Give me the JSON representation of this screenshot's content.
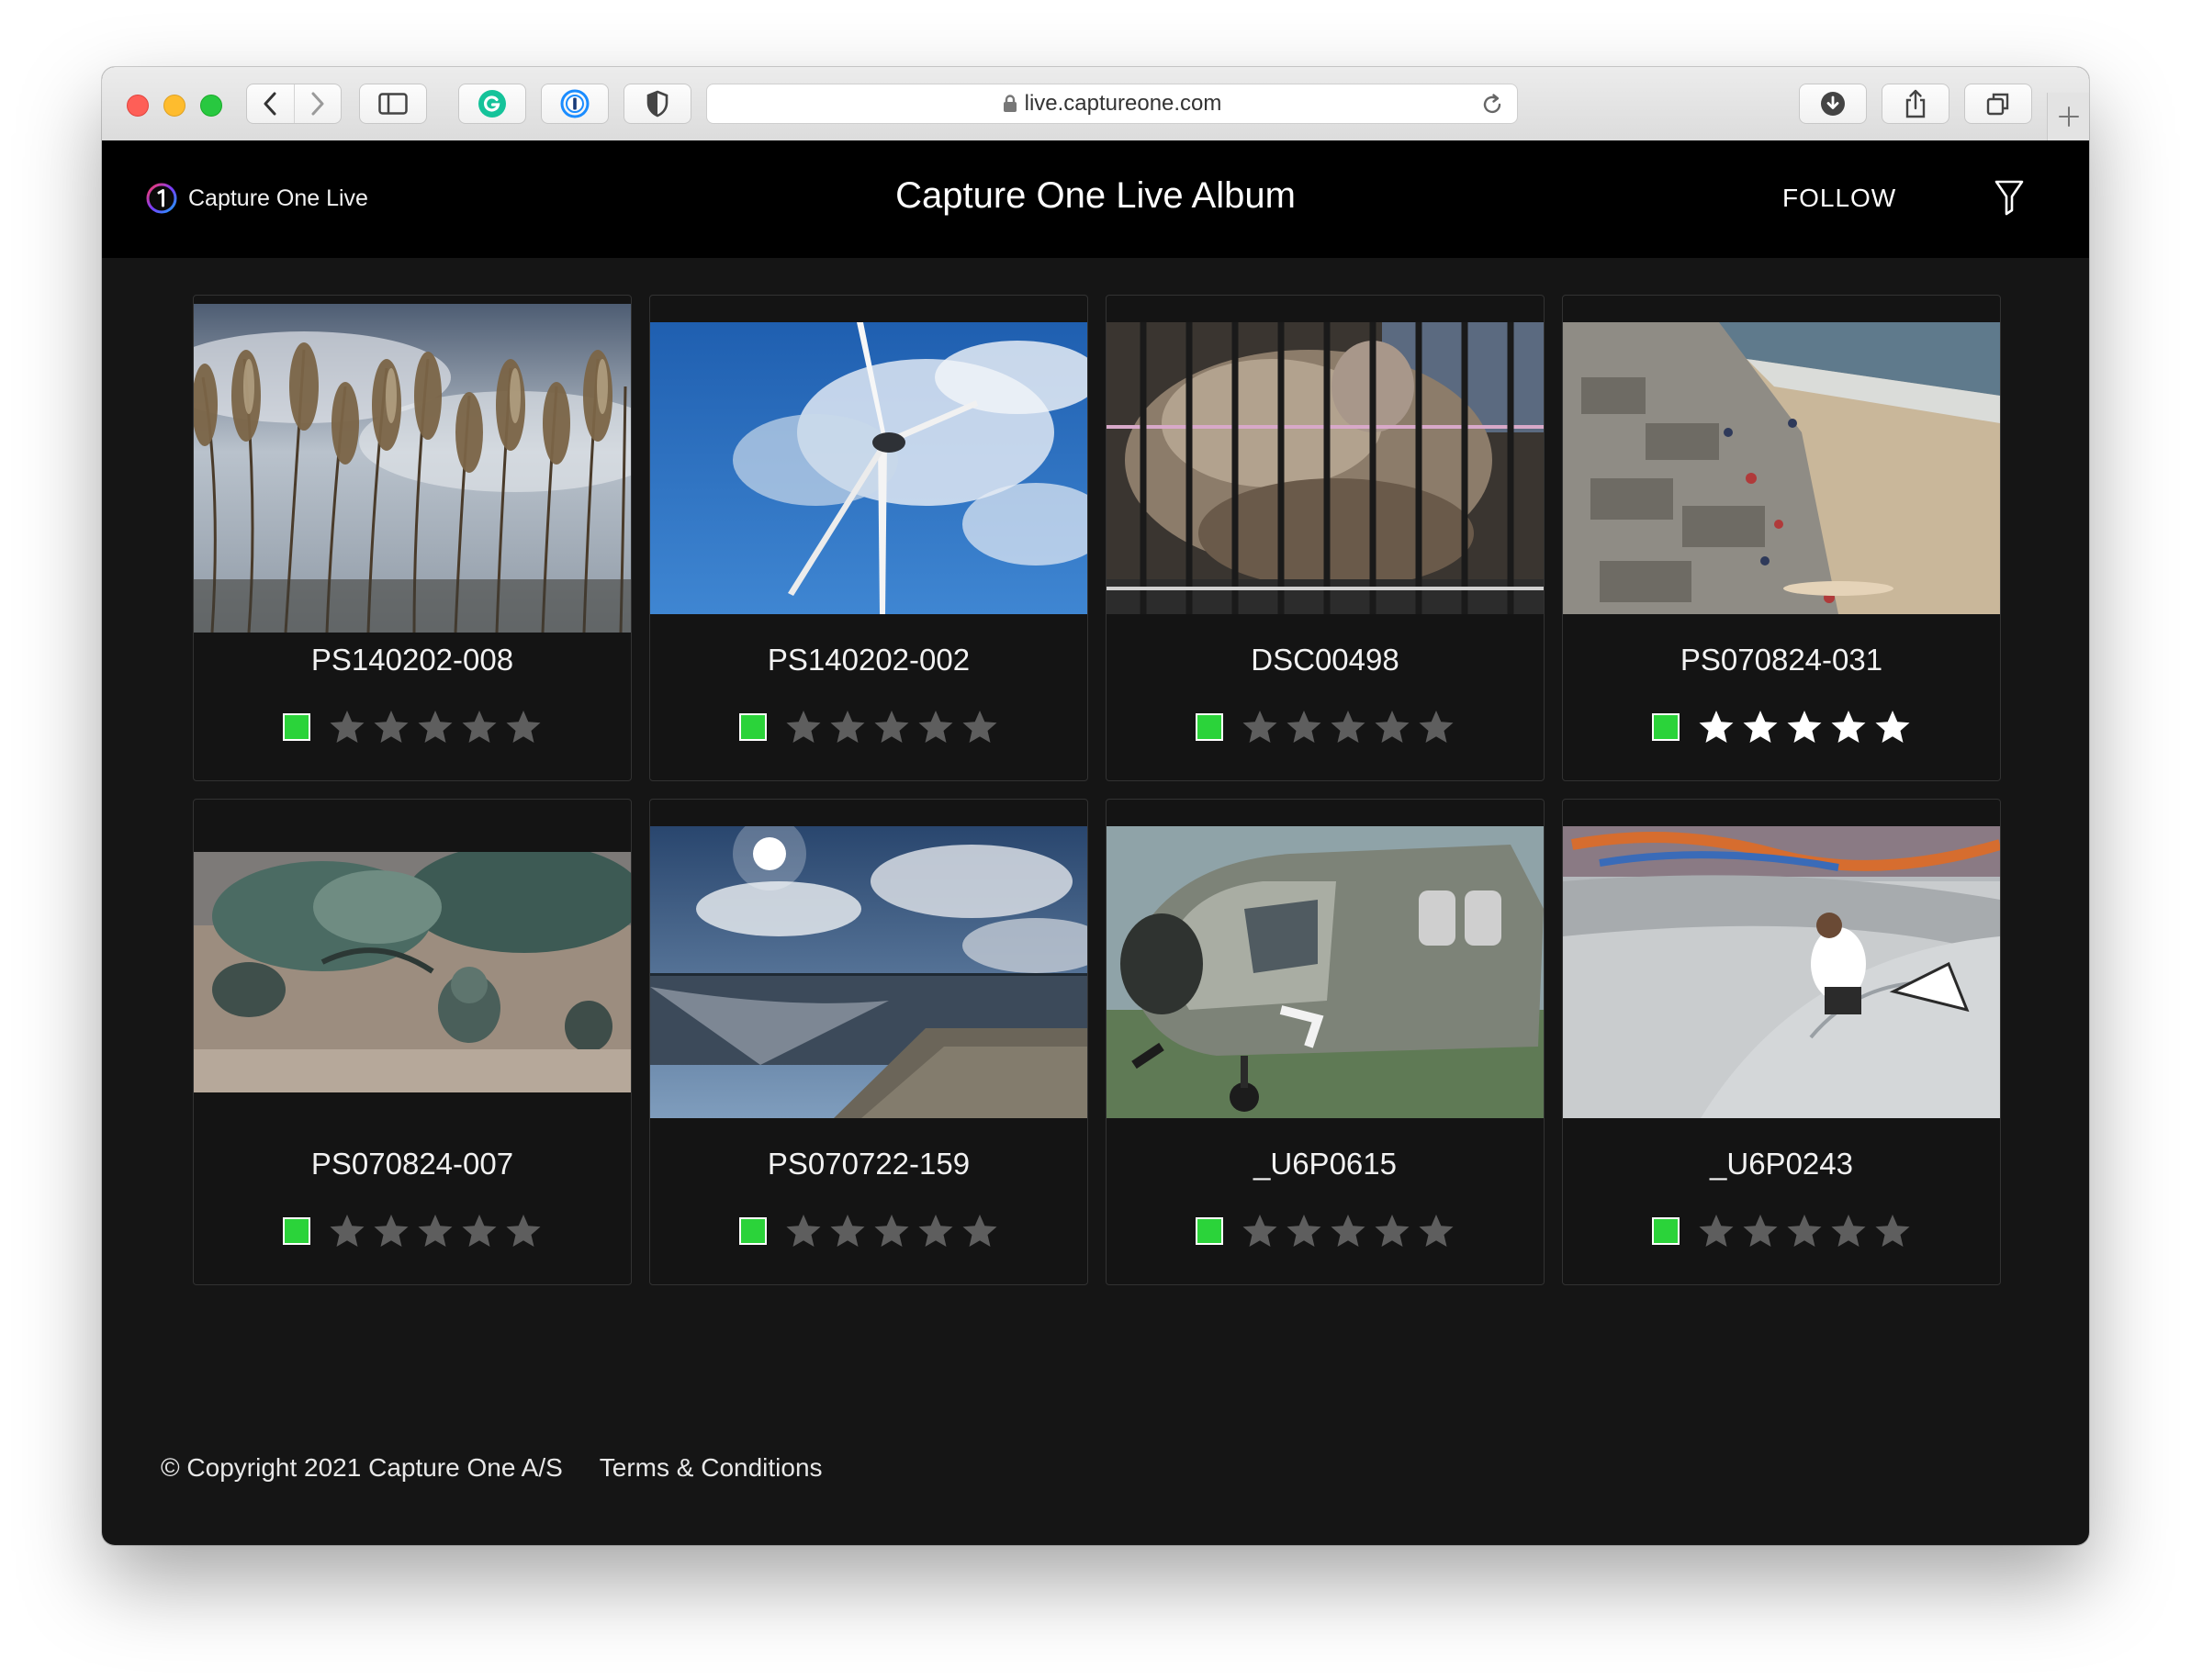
{
  "browser": {
    "url": "live.captureone.com"
  },
  "header": {
    "brand": "Capture One Live",
    "title": "Capture One Live Album",
    "follow_label": "FOLLOW",
    "filter_icon": "filter-icon"
  },
  "colors": {
    "page_bg": "#151515",
    "header_bg": "#000000",
    "color_tag": "#2bd33a",
    "star_off": "#5e5e5e",
    "star_on": "#ffffff"
  },
  "photos": [
    {
      "name": "PS140202-008",
      "rating": 0,
      "color_tag": "green"
    },
    {
      "name": "PS140202-002",
      "rating": 0,
      "color_tag": "green"
    },
    {
      "name": "DSC00498",
      "rating": 0,
      "color_tag": "green"
    },
    {
      "name": "PS070824-031",
      "rating": 5,
      "color_tag": "green"
    },
    {
      "name": "PS070824-007",
      "rating": 0,
      "color_tag": "green"
    },
    {
      "name": "PS070722-159",
      "rating": 0,
      "color_tag": "green"
    },
    {
      "name": "_U6P0615",
      "rating": 0,
      "color_tag": "green"
    },
    {
      "name": "_U6P0243",
      "rating": 0,
      "color_tag": "green"
    }
  ],
  "footer": {
    "copyright": "© Copyright 2021 Capture One A/S",
    "terms": "Terms & Conditions"
  }
}
